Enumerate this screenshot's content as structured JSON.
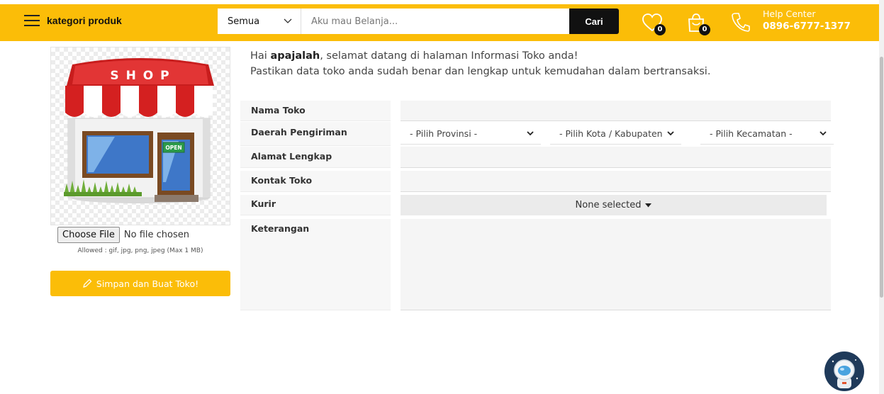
{
  "header": {
    "menu_label": "kategori produk",
    "search_category": "Semua",
    "search_placeholder": "Aku mau Belanja...",
    "search_button": "Cari",
    "wishlist_count": "0",
    "cart_count": "0",
    "help_title": "Help Center",
    "help_phone": "0896-6777-1377"
  },
  "sidebar": {
    "shop_sign": "S H O P",
    "open_sign": "OPEN",
    "file_button": "Choose File",
    "file_status": "No file chosen",
    "allowed_text": "Allowed : gif, jpg, png, jpeg (Max 1 MB)",
    "save_button": "Simpan dan Buat Toko!"
  },
  "greeting": {
    "prefix": "Hai ",
    "username": "apajalah",
    "line1_suffix": ", selamat datang di halaman Informasi Toko anda!",
    "line2": "Pastikan data toko anda sudah benar dan lengkap untuk kemudahan dalam bertransaksi."
  },
  "form": {
    "store_name_label": "Nama Toko",
    "store_name_value": "",
    "shipping_label": "Daerah Pengiriman",
    "province_select": "- Pilih Provinsi -",
    "city_select": "- Pilih Kota / Kabupaten -",
    "district_select": "- Pilih Kecamatan -",
    "address_label": "Alamat Lengkap",
    "address_value": "",
    "contact_label": "Kontak Toko",
    "contact_value": "",
    "courier_label": "Kurir",
    "courier_value": "None selected",
    "notes_label": "Keterangan",
    "notes_value": ""
  },
  "colors": {
    "accent": "#fbbd08",
    "dark": "#111111"
  }
}
